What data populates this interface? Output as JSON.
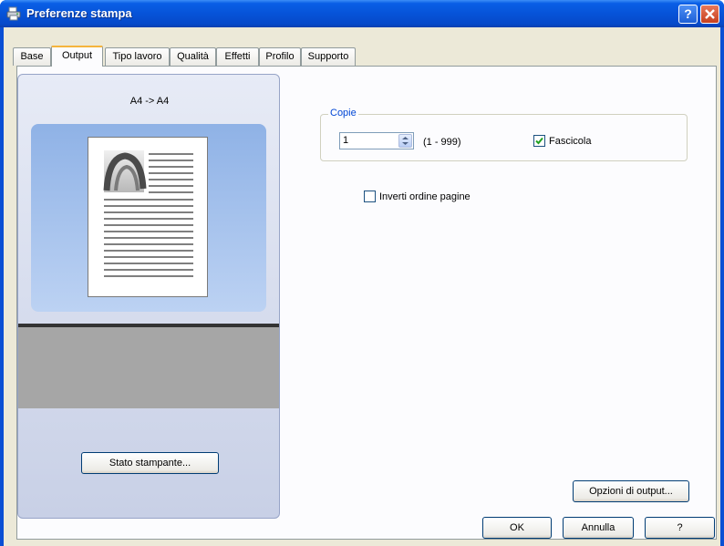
{
  "window": {
    "title": "Preferenze stampa"
  },
  "tabs": [
    {
      "label": "Base"
    },
    {
      "label": "Output"
    },
    {
      "label": "Tipo lavoro"
    },
    {
      "label": "Qualità"
    },
    {
      "label": "Effetti"
    },
    {
      "label": "Profilo"
    },
    {
      "label": "Supporto"
    }
  ],
  "preview": {
    "paper_label": "A4 -> A4",
    "status_button_label": "Stato stampante..."
  },
  "copies": {
    "group_label": "Copie",
    "value": "1",
    "range": "(1 - 999)",
    "collate_label": "Fascicola",
    "collate_checked": true
  },
  "reverse_order": {
    "label": "Inverti ordine pagine",
    "checked": false
  },
  "output_options_label": "Opzioni di output...",
  "dialog_buttons": {
    "ok": "OK",
    "cancel": "Annulla",
    "help": "?"
  }
}
